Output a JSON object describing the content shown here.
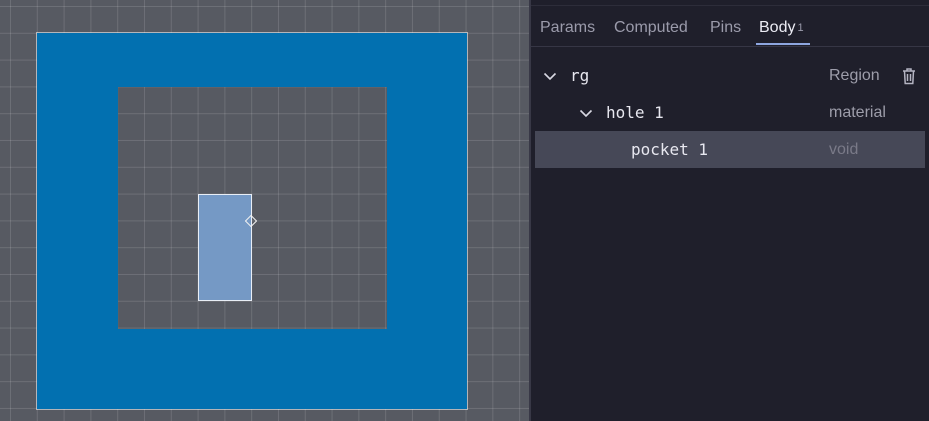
{
  "colors": {
    "canvas_bg": "#575a62",
    "region_fill": "#0270b0",
    "pocket_fill": "#7599c5",
    "panel_bg": "#1f1f2b",
    "selected_row": "#464857",
    "tab_accent": "#8ea6e0"
  },
  "tabs": [
    {
      "label": "Params",
      "active": false
    },
    {
      "label": "Computed",
      "active": false
    },
    {
      "label": "Pins",
      "active": false
    },
    {
      "label": "Body",
      "active": true,
      "count": "1"
    }
  ],
  "tree": [
    {
      "label": "rg",
      "type": "Region",
      "expanded": true,
      "icon": "chevron-down-icon",
      "action_icon": "trash-icon"
    },
    {
      "label": "hole 1",
      "type": "material",
      "expanded": true,
      "icon": "chevron-down-icon"
    },
    {
      "label": "pocket 1",
      "type": "void",
      "selected": true
    }
  ],
  "canvas": {
    "shapes": [
      "region-outer",
      "hole-inner",
      "pocket-rect"
    ],
    "handle_icon": "diamond-handle-icon"
  }
}
